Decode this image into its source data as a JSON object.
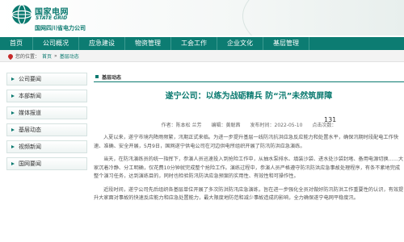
{
  "header": {
    "brand_cn": "国家电网",
    "brand_en": "STATE GRID",
    "brand_sub": "国网四川省电力公司",
    "accent": "#0b7a70"
  },
  "nav": {
    "items": [
      "首页",
      "公司概况",
      "应急建设",
      "物资管理",
      "工会工作",
      "企业文化",
      "基层管理"
    ]
  },
  "breadcrumb": {
    "prefix": "您的位置：",
    "home": "首页",
    "sep": "»",
    "current": "基层动态"
  },
  "sidebar": {
    "items": [
      "公司要闻",
      "本部新闻",
      "媒体报道",
      "基层动态",
      "视频新闻",
      "国网要闻"
    ]
  },
  "section": {
    "label": "基层动态"
  },
  "article": {
    "title": "遂宁公司：以练为战砺精兵 防“汛”未然筑屏障",
    "meta": "作者：陈本松 兰芳　　编辑：黄聪茜　　发布时间：2022-05-10　　点击次数：",
    "views": "131",
    "paragraphs": [
      "入夏以来，遂宁市境内降雨频繁，汛期正式来临。为进一步提升基层一线防汛抗洪应急反应能力和处置水平，确保汛期时段配电工作快速、准确、安全开展，5月9日，国网遂宁供电公司在河边供电所组织开展了防汛防洪应急演练。",
      "当天，在防汛演练员的统一指挥下，参演人员迅速投入到抢险工作中，从抽水泵排水、填装沙袋、进水处沙袋封堵、备用电源切换……大家沉着冷静、分工明确，仅花费10分钟就完成整个抢险工作。演练过程中，参演人员严格遵守防汛防洪应急事故处理程序，有条不紊地完成整个演习任务，达到演练目的，同时也检验防汛防洪应急预案的实用性、有效性和可操作性。",
      "近段时间，遂宁公司先后组织各基层单位开展了多次防洪防汛应急演练，旨在进一步强化全员对做好防汛防洪工作重要性的认识，有效提升大家面对事故的快速反应能力和应急处置能力，最大限度地防范和减少事故造成的影响，全力确保遂宁电网平稳度汛。"
    ]
  }
}
